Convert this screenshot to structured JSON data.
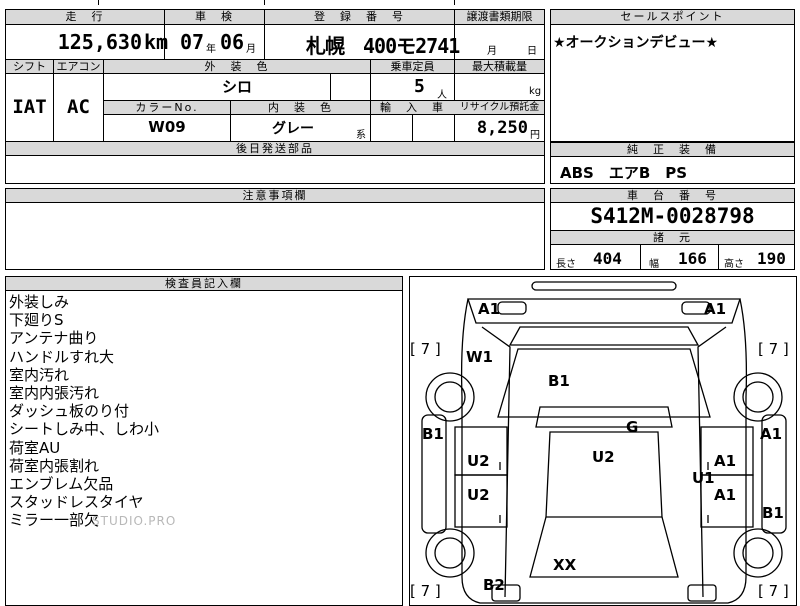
{
  "sheet": {
    "mileage": {
      "header": "走　行",
      "value": "125,630",
      "unit": "km"
    },
    "inspection": {
      "header": "車　検",
      "year": "07",
      "year_unit": "年",
      "month": "06",
      "month_unit": "月"
    },
    "registration": {
      "header": "登　録　番　号",
      "value": "札幌　400モ2741"
    },
    "transfer": {
      "header": "譲渡書類期限",
      "month_unit": "月",
      "day_unit": "日"
    },
    "sales_point": {
      "header": "セールスポイント",
      "text": "★オークションデビュー★"
    },
    "shift": {
      "header": "シフト",
      "value": "IAT"
    },
    "aircon": {
      "header": "エアコン",
      "value": "AC"
    },
    "exterior_color": {
      "header": "外　装　色",
      "value": "シロ"
    },
    "capacity": {
      "header": "乗車定員",
      "value": "5",
      "unit": "人"
    },
    "max_load": {
      "header": "最大積載量",
      "unit": "kg"
    },
    "color_no": {
      "header": "カラーNo.",
      "value": "W09"
    },
    "interior_color": {
      "header": "内　装　色",
      "value": "グレー",
      "suffix": "系"
    },
    "import": {
      "header": "輸　入　車"
    },
    "recycle": {
      "header": "リサイクル預託金",
      "value": "8,250",
      "unit": "円"
    },
    "later_parts": {
      "header": "後日発送部品"
    },
    "equipment": {
      "header": "純　正　装　備",
      "value": "ABS　エアB　PS"
    },
    "notes": {
      "header": "注意事項欄"
    },
    "chassis": {
      "header": "車　台　番　号",
      "value": "S412M-0028798"
    },
    "specs": {
      "header": "諸　元",
      "length_label": "長さ",
      "length": "404",
      "width_label": "幅",
      "width": "166",
      "height_label": "高さ",
      "height": "190"
    },
    "inspector": {
      "header": "検査員記入欄",
      "lines": [
        "外装しみ",
        "下廻りS",
        "アンテナ曲り",
        "ハンドルすれ大",
        "室内汚れ",
        "室内内張汚れ",
        "ダッシュ板のり付",
        "シートしみ中、しわ小",
        "荷室AU",
        "荷室内張割れ",
        "エンブレム欠品",
        "スタッドレスタイヤ",
        "ミラー一部欠"
      ]
    },
    "watermark": "STUDIO.PRO"
  },
  "diagram": {
    "labels": {
      "a1_tl": "A1",
      "a1_tr": "A1",
      "b7_tl": "[ 7 ]",
      "b7_tr": "[ 7 ]",
      "w1": "W1",
      "b1_roof": "B1",
      "b1_left": "B1",
      "a1_right": "A1",
      "g": "G",
      "u2_center": "U2",
      "u2_left_top": "U2",
      "u2_left_bottom": "U2",
      "a1_rdoor1": "A1",
      "u1": "U1",
      "a1_rdoor2": "A1",
      "b1_right": "B1",
      "xx": "XX",
      "b2": "B2",
      "b7_bl": "[ 7 ]",
      "b7_br": "[ 7 ]"
    }
  }
}
